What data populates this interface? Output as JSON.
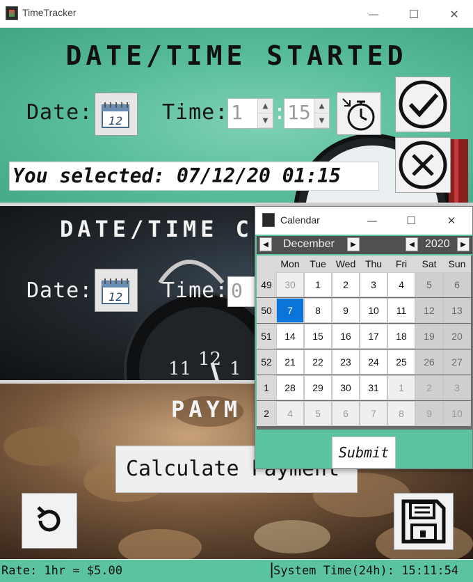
{
  "window": {
    "title": "TimeTracker",
    "icons": {
      "minimize": "minimize-icon",
      "maximize": "maximize-icon",
      "close": "close-icon"
    }
  },
  "started": {
    "banner": "DATE/TIME STARTED",
    "date_label": "Date:",
    "time_label": "Time:",
    "hour": "1",
    "minute": "15",
    "colon": ":",
    "selected_text": "You selected: 07/12/20 01:15"
  },
  "completed": {
    "banner": "DATE/TIME C",
    "date_label": "Date:",
    "time_label": "Time:",
    "hour": "0"
  },
  "payment": {
    "banner": "PAYM",
    "calculate_label": "Calculate Payment"
  },
  "status_bar": {
    "rate": "Rate: 1hr = $5.00",
    "separator": "|",
    "system_time": "System Time(24h): 15:11:54"
  },
  "calendar": {
    "title": "Calendar",
    "month": "December",
    "year": "2020",
    "weekdays": [
      "Mon",
      "Tue",
      "Wed",
      "Thu",
      "Fri",
      "Sat",
      "Sun"
    ],
    "weeks": [
      {
        "num": "49",
        "days": [
          "30",
          "1",
          "2",
          "3",
          "4",
          "5",
          "6"
        ]
      },
      {
        "num": "50",
        "days": [
          "7",
          "8",
          "9",
          "10",
          "11",
          "12",
          "13"
        ]
      },
      {
        "num": "51",
        "days": [
          "14",
          "15",
          "16",
          "17",
          "18",
          "19",
          "20"
        ]
      },
      {
        "num": "52",
        "days": [
          "21",
          "22",
          "23",
          "24",
          "25",
          "26",
          "27"
        ]
      },
      {
        "num": "1",
        "days": [
          "28",
          "29",
          "30",
          "31",
          "1",
          "2",
          "3"
        ]
      },
      {
        "num": "2",
        "days": [
          "4",
          "5",
          "6",
          "7",
          "8",
          "9",
          "10"
        ]
      }
    ],
    "selected_day": "7",
    "submit_label": "Submit",
    "colors": {
      "selected": "#0a74d8",
      "accent": "#5cc39f"
    }
  }
}
